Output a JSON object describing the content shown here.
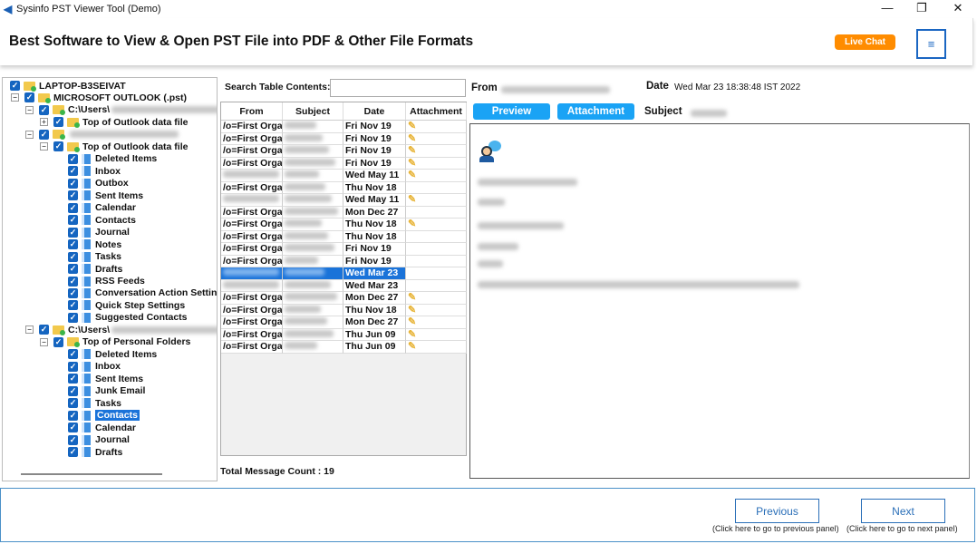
{
  "window": {
    "title": "Sysinfo PST Viewer Tool (Demo)",
    "minimize": "—",
    "maximize": "❐",
    "close": "✕"
  },
  "header": {
    "title": "Best Software to View & Open PST File into PDF & Other File Formats",
    "live_chat": "Live Chat",
    "menu_icon": "≡"
  },
  "tree": [
    {
      "label": "LAPTOP-B3SEIVAT",
      "level": 0,
      "icon": "folder"
    },
    {
      "label": "MICROSOFT OUTLOOK (.pst)",
      "level": 1,
      "icon": "folder",
      "exp": "-"
    },
    {
      "label": "C:\\Users\\",
      "level": 2,
      "icon": "folder",
      "exp": "-",
      "blur": true
    },
    {
      "label": "Top of Outlook data file",
      "level": 3,
      "icon": "folder",
      "exp": "+"
    },
    {
      "label": "",
      "level": 2,
      "icon": "folder",
      "exp": "-",
      "blur": true
    },
    {
      "label": "Top of Outlook data file",
      "level": 3,
      "icon": "folder",
      "exp": "-"
    },
    {
      "label": "Deleted Items",
      "level": 4
    },
    {
      "label": "Inbox",
      "level": 4
    },
    {
      "label": "Outbox",
      "level": 4
    },
    {
      "label": "Sent Items",
      "level": 4
    },
    {
      "label": "Calendar",
      "level": 4
    },
    {
      "label": "Contacts",
      "level": 4
    },
    {
      "label": "Journal",
      "level": 4
    },
    {
      "label": "Notes",
      "level": 4
    },
    {
      "label": "Tasks",
      "level": 4
    },
    {
      "label": "Drafts",
      "level": 4
    },
    {
      "label": "RSS Feeds",
      "level": 4
    },
    {
      "label": "Conversation Action Setting",
      "level": 4
    },
    {
      "label": "Quick Step Settings",
      "level": 4
    },
    {
      "label": "Suggested Contacts",
      "level": 4
    },
    {
      "label": "C:\\Users\\",
      "level": 2,
      "icon": "folder",
      "exp": "-",
      "blur": true
    },
    {
      "label": "Top of Personal Folders",
      "level": 3,
      "icon": "folder",
      "exp": "-"
    },
    {
      "label": "Deleted Items",
      "level": 4
    },
    {
      "label": "Inbox",
      "level": 4
    },
    {
      "label": "Sent Items",
      "level": 4
    },
    {
      "label": "Junk Email",
      "level": 4
    },
    {
      "label": "Tasks",
      "level": 4
    },
    {
      "label": "Contacts",
      "level": 4,
      "selected": true
    },
    {
      "label": "Calendar",
      "level": 4
    },
    {
      "label": "Journal",
      "level": 4
    },
    {
      "label": "Drafts",
      "level": 4
    }
  ],
  "search": {
    "label": "Search Table Contents:",
    "value": ""
  },
  "table": {
    "columns": [
      "From",
      "Subject",
      "Date",
      "Attachment"
    ],
    "rows": [
      {
        "from": "/o=First Orga",
        "date": "Fri Nov 19",
        "att": true
      },
      {
        "from": "/o=First Orga",
        "date": "Fri Nov 19",
        "att": true
      },
      {
        "from": "/o=First Orga",
        "date": "Fri Nov 19",
        "att": true
      },
      {
        "from": "/o=First Orga",
        "date": "Fri Nov 19",
        "att": true
      },
      {
        "from": "",
        "date": "Wed May 11",
        "att": true
      },
      {
        "from": "/o=First Orga",
        "date": "Thu Nov 18",
        "att": false
      },
      {
        "from": "",
        "date": "Wed May 11",
        "att": true
      },
      {
        "from": "/o=First Orga",
        "date": "Mon Dec 27",
        "att": false
      },
      {
        "from": "/o=First Orga",
        "date": "Thu Nov 18",
        "att": true
      },
      {
        "from": "/o=First Orga",
        "date": "Thu Nov 18",
        "att": false
      },
      {
        "from": "/o=First Orga",
        "date": "Fri Nov 19",
        "att": false
      },
      {
        "from": "/o=First Orga",
        "date": "Fri Nov 19",
        "att": false
      },
      {
        "from": "",
        "date": "Wed Mar 23",
        "att": false,
        "selected": true
      },
      {
        "from": "",
        "date": "Wed Mar 23",
        "att": false
      },
      {
        "from": "/o=First Orga",
        "date": "Mon Dec 27",
        "att": true
      },
      {
        "from": "/o=First Orga",
        "date": "Thu Nov 18",
        "att": true
      },
      {
        "from": "/o=First Orga",
        "date": "Mon Dec 27",
        "att": true
      },
      {
        "from": "/o=First Orga",
        "date": "Thu Jun 09",
        "att": true
      },
      {
        "from": "/o=First Orga",
        "date": "Thu Jun 09",
        "att": true
      }
    ]
  },
  "total_count": "Total Message Count : 19",
  "detail": {
    "from_label": "From",
    "date_label": "Date",
    "date_value": "Wed Mar 23 18:38:48 IST 2022",
    "subject_label": "Subject",
    "preview_btn": "Preview",
    "attachment_btn": "Attachment"
  },
  "footer": {
    "previous": "Previous",
    "previous_caption": "(Click here to go to previous panel)",
    "next": "Next",
    "next_caption": "(Click here to go to next panel)"
  },
  "colors": {
    "accent": "#1aa3f5",
    "live_chat": "#ff8c00",
    "selection": "#1a73d9"
  }
}
